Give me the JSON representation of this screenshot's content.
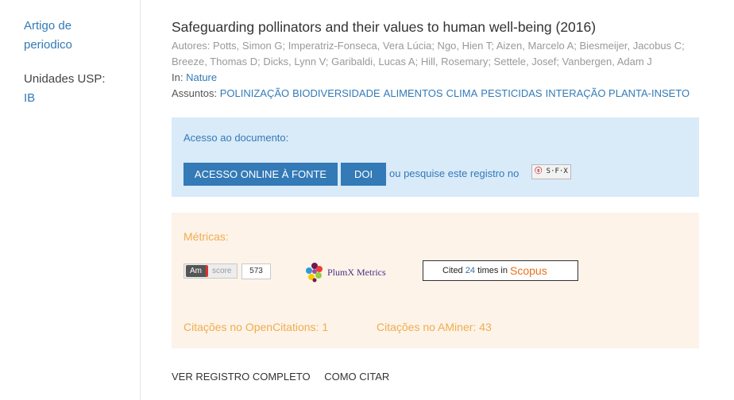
{
  "sidebar": {
    "doc_type": "Artigo de periodico",
    "units_label": "Unidades USP:",
    "units_value": "IB"
  },
  "record": {
    "title": "Safeguarding pollinators and their values to human well-being (2016)",
    "authors_label": "Autores:",
    "authors": "Potts, Simon G; Imperatriz-Fonseca, Vera Lúcia; Ngo, Hien T; Aizen, Marcelo A; Biesmeijer, Jacobus C; Breeze, Thomas D; Dicks, Lynn V; Garibaldi, Lucas A; Hill, Rosemary; Settele, Josef; Vanbergen, Adam J",
    "in_label": "In:",
    "in_value": "Nature",
    "subjects_label": "Assuntos:",
    "subjects": [
      "POLINIZAÇÃO",
      "BIODIVERSIDADE",
      "ALIMENTOS",
      "CLIMA",
      "PESTICIDAS",
      "INTERAÇÃO PLANTA-INSETO"
    ]
  },
  "access": {
    "label": "Acesso ao documento:",
    "online_button": "ACESSO ONLINE À FONTE",
    "doi_button": "DOI",
    "search_text": "ou pesquise este registro no",
    "sfx_badge": "S·F·X"
  },
  "metrics": {
    "label": "Métricas:",
    "altmetric": {
      "badge_left": "Am",
      "badge_right": "score",
      "score": "573"
    },
    "plumx": {
      "text": "PlumX Metrics"
    },
    "scopus": {
      "prefix": "Cited",
      "count": "24",
      "suffix": "times in",
      "brand": "Scopus"
    },
    "opencitations": "Citações no OpenCitations: 1",
    "aminer": "Citações no AMiner: 43"
  },
  "footer": {
    "full_record": "VER REGISTRO COMPLETO",
    "cite": "COMO CITAR"
  },
  "colors": {
    "link": "#337ab7",
    "access_bg": "#d9eaf9",
    "metrics_bg": "#fdf3e9",
    "metrics_text": "#f0ad4e",
    "scopus_brand": "#e9711c"
  }
}
